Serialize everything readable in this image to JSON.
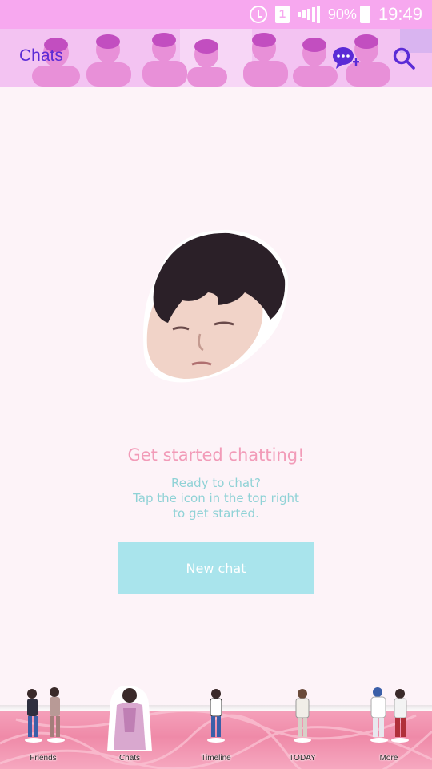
{
  "status_bar": {
    "sim_slot": "1",
    "battery_percent": "90%",
    "time": "19:49",
    "icons": [
      "alarm-icon",
      "sim-icon",
      "signal-icon",
      "battery-icon"
    ]
  },
  "header": {
    "title": "Chats",
    "actions": [
      {
        "name": "new-chat-icon"
      },
      {
        "name": "search-icon"
      }
    ],
    "accent_color": "#5b2bd6"
  },
  "empty_state": {
    "title": "Get started chatting!",
    "subtitle_lines": [
      "Ready to chat?",
      "Tap the icon in the top right",
      "to get started."
    ],
    "button_label": "New chat",
    "title_color": "#f29bb8",
    "subtitle_color": "#8fd2d6",
    "button_color": "#a9e4ec"
  },
  "tabs": [
    {
      "label": "Friends"
    },
    {
      "label": "Chats",
      "selected": true
    },
    {
      "label": "Timeline"
    },
    {
      "label": "TODAY"
    },
    {
      "label": "More"
    }
  ]
}
